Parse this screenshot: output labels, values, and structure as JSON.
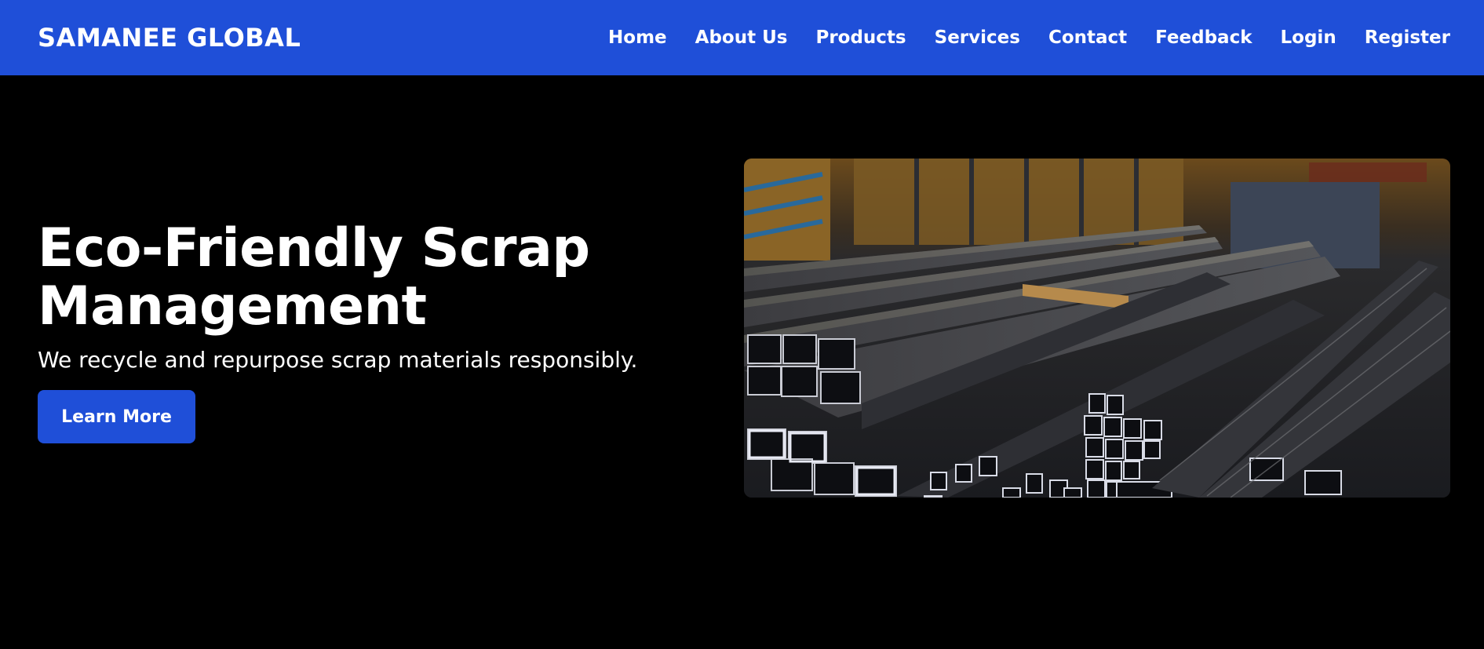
{
  "header": {
    "brand": "SAMANEE GLOBAL",
    "nav": [
      {
        "label": "Home"
      },
      {
        "label": "About Us"
      },
      {
        "label": "Products"
      },
      {
        "label": "Services"
      },
      {
        "label": "Contact"
      },
      {
        "label": "Feedback"
      },
      {
        "label": "Login"
      },
      {
        "label": "Register"
      }
    ]
  },
  "hero": {
    "title": "Eco-Friendly Scrap Management",
    "subtitle": "We recycle and repurpose scrap materials responsibly.",
    "cta_label": "Learn More",
    "image_subject": "stacked steel square tubes in a warehouse"
  },
  "colors": {
    "brand_blue": "#1f4fd8",
    "background": "#000000",
    "text": "#ffffff"
  }
}
